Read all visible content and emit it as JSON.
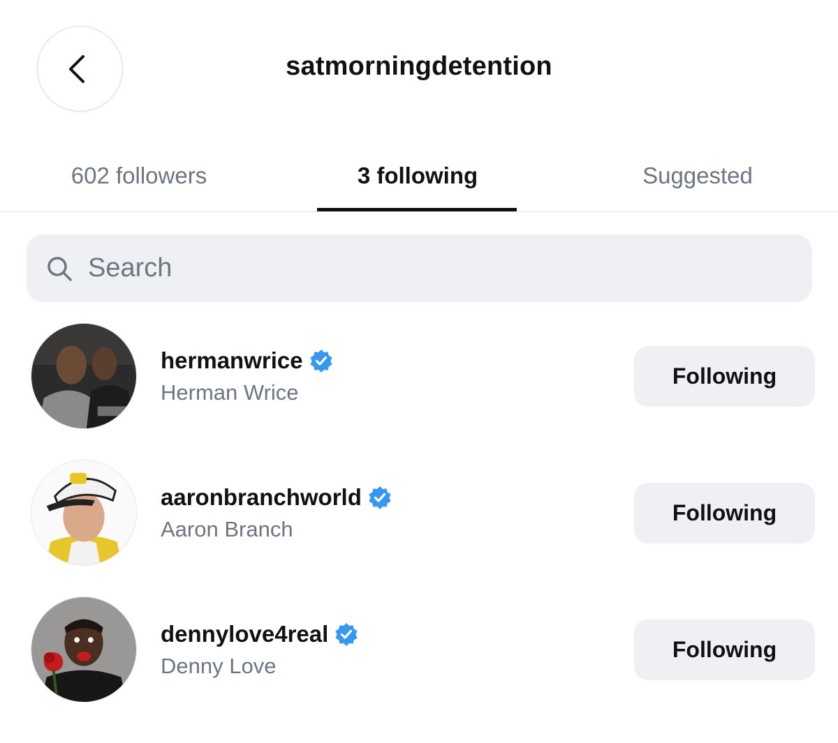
{
  "header": {
    "title": "satmorningdetention",
    "back_icon": "chevron-left-icon"
  },
  "tabs": [
    {
      "label": "602 followers",
      "active": false
    },
    {
      "label": "3 following",
      "active": true
    },
    {
      "label": "Suggested",
      "active": false
    }
  ],
  "search": {
    "placeholder": "Search",
    "value": "",
    "icon": "search-icon"
  },
  "users": [
    {
      "username": "hermanwrice",
      "name": "Herman Wrice",
      "verified": true,
      "button_label": "Following"
    },
    {
      "username": "aaronbranchworld",
      "name": "Aaron Branch",
      "verified": true,
      "button_label": "Following"
    },
    {
      "username": "dennylove4real",
      "name": "Denny Love",
      "verified": true,
      "button_label": "Following"
    }
  ],
  "colors": {
    "verified_blue": "#3897f0",
    "tab_inactive": "#6c7580",
    "button_bg": "#eff0f4",
    "search_bg": "#eff0f4"
  }
}
